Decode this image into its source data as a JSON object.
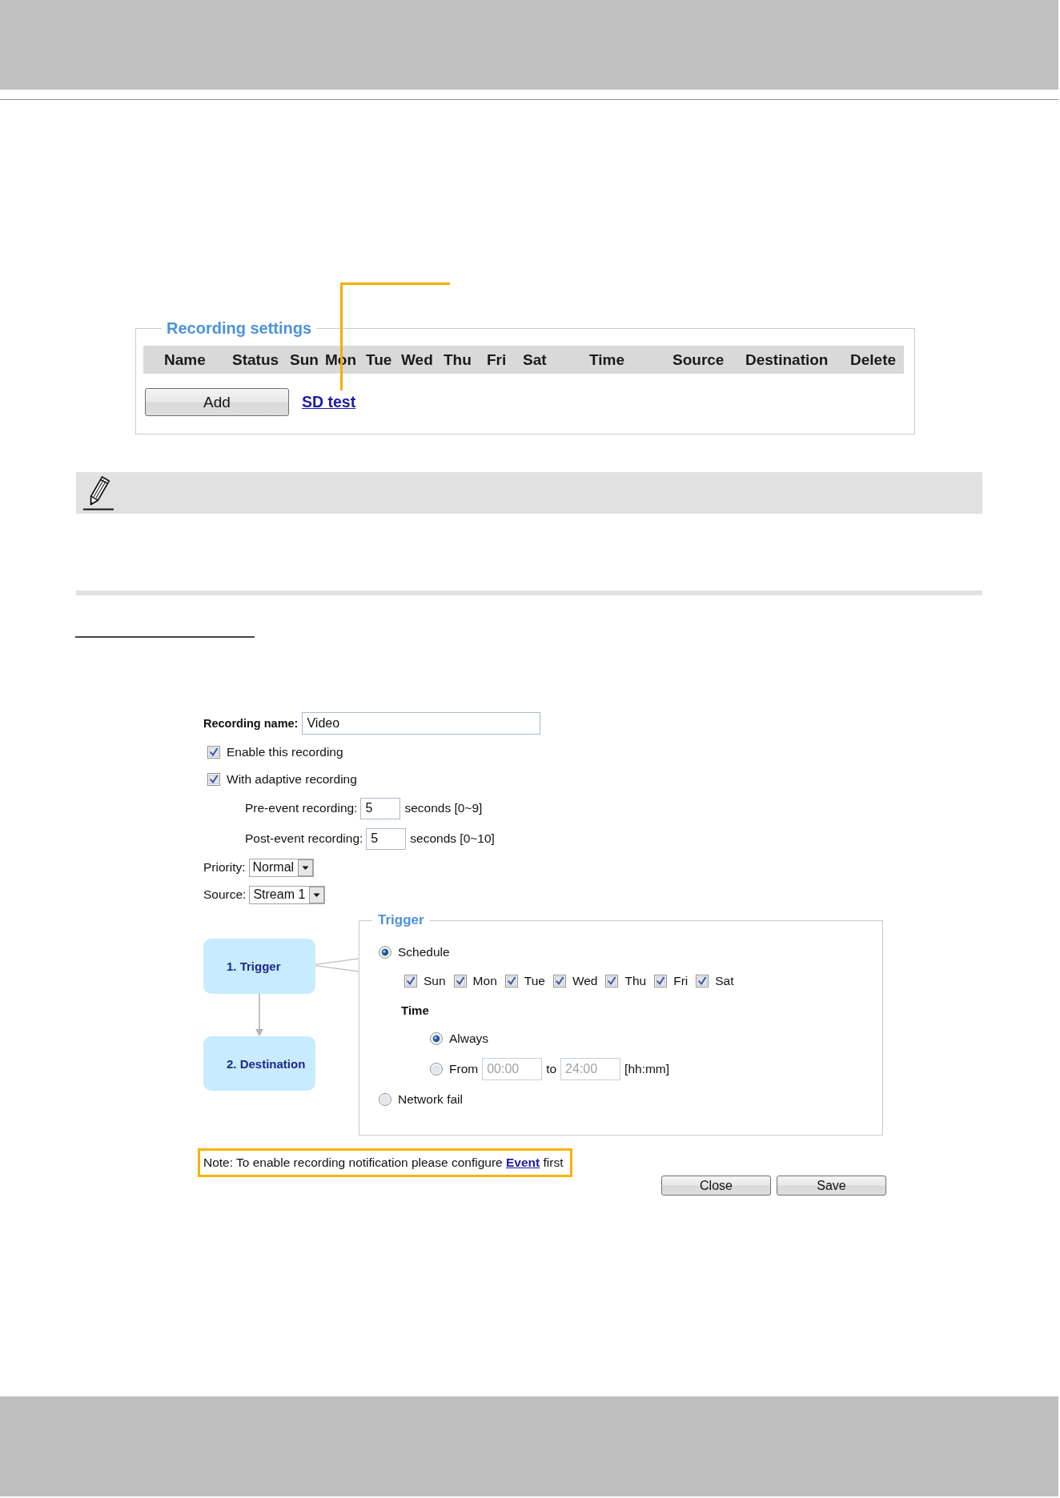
{
  "recording_settings": {
    "legend": "Recording settings",
    "columns": [
      "Name",
      "Status",
      "Sun",
      "Mon",
      "Tue",
      "Wed",
      "Thu",
      "Fri",
      "Sat",
      "Time",
      "Source",
      "Destination",
      "Delete"
    ],
    "add_button": "Add",
    "link": "SD test"
  },
  "recording_form": {
    "name_label": "Recording name:",
    "name_value": "Video",
    "options": [
      {
        "label": "Enable this recording",
        "checked": true
      },
      {
        "label": "With adaptive recording",
        "checked": true,
        "children": [
          {
            "label": "Pre-event recording:",
            "value": "5",
            "unit": "seconds [0~9]"
          },
          {
            "label": "Post-event recording:",
            "value": "5",
            "unit": "seconds [0~10]"
          }
        ]
      }
    ],
    "selects": [
      {
        "label": "Priority:",
        "value": "Normal"
      },
      {
        "label": "Source:",
        "value": "Stream 1"
      }
    ],
    "steps": [
      "1. Trigger",
      "2. Destination"
    ],
    "trigger": {
      "legend": "Trigger",
      "options": [
        {
          "kind": "schedule",
          "label": "Schedule",
          "selected": true,
          "days": [
            {
              "label": "Sun",
              "checked": true
            },
            {
              "label": "Mon",
              "checked": true
            },
            {
              "label": "Tue",
              "checked": true
            },
            {
              "label": "Wed",
              "checked": true
            },
            {
              "label": "Thu",
              "checked": true
            },
            {
              "label": "Fri",
              "checked": true
            },
            {
              "label": "Sat",
              "checked": true
            }
          ],
          "time_heading": "Time",
          "time_options": [
            {
              "kind": "always",
              "label": "Always",
              "selected": true
            },
            {
              "kind": "range",
              "label": "From",
              "selected": false,
              "disabled": true,
              "start": "00:00",
              "separator": "to",
              "end": "24:00",
              "format": "[hh:mm]"
            }
          ]
        },
        {
          "kind": "plain",
          "label": "Network fail",
          "selected": false
        }
      ]
    },
    "note": {
      "before": "Note: To enable recording notification please configure ",
      "link": "Event",
      "after": " first"
    },
    "buttons": [
      "Close",
      "Save"
    ]
  }
}
